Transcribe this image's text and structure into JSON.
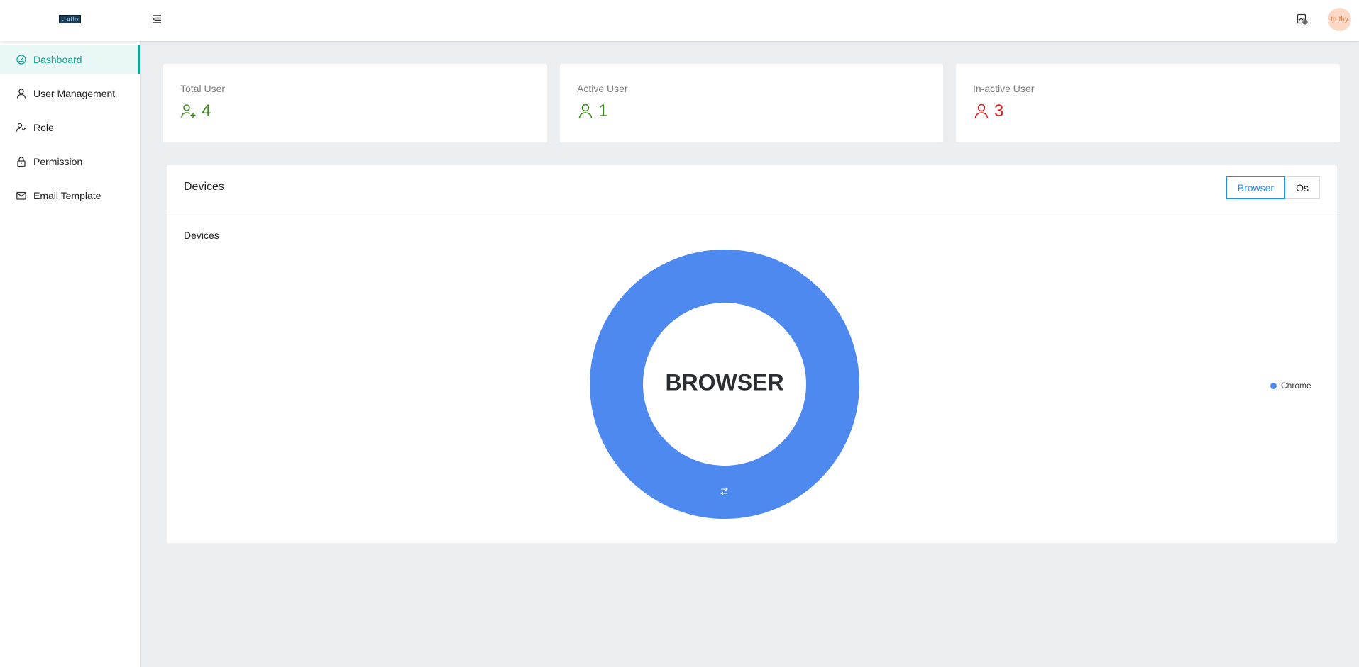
{
  "header": {
    "logo_text": "truthy",
    "avatar_text": "truthy",
    "icons": {
      "menu": "menu-fold-icon",
      "report": "image-report-icon"
    }
  },
  "sidebar": {
    "items": [
      {
        "label": "Dashboard",
        "icon": "dashboard-icon",
        "active": true
      },
      {
        "label": "User Management",
        "icon": "user-icon",
        "active": false
      },
      {
        "label": "Role",
        "icon": "role-icon",
        "active": false
      },
      {
        "label": "Permission",
        "icon": "lock-icon",
        "active": false
      },
      {
        "label": "Email Template",
        "icon": "mail-icon",
        "active": false
      }
    ]
  },
  "stats": [
    {
      "label": "Total User",
      "value": "4",
      "icon": "user-add-icon",
      "color": "#3a8a1c"
    },
    {
      "label": "Active User",
      "value": "1",
      "icon": "user-icon",
      "color": "#3a8a1c"
    },
    {
      "label": "In-active User",
      "value": "3",
      "icon": "user-icon",
      "color": "#e02020"
    }
  ],
  "devices": {
    "title": "Devices",
    "toggle": [
      {
        "label": "Browser",
        "selected": true
      },
      {
        "label": "Os",
        "selected": false
      }
    ]
  },
  "chart_data": {
    "type": "pie",
    "title": "Devices",
    "center_label": "BROWSER",
    "categories": [
      "Chrome"
    ],
    "values": [
      1
    ],
    "colors": [
      "#4e89f0"
    ],
    "legend": "right"
  },
  "colors": {
    "accent": "#16a596",
    "primary": "#1890ff",
    "positive": "#3a8a1c",
    "negative": "#e02020"
  }
}
